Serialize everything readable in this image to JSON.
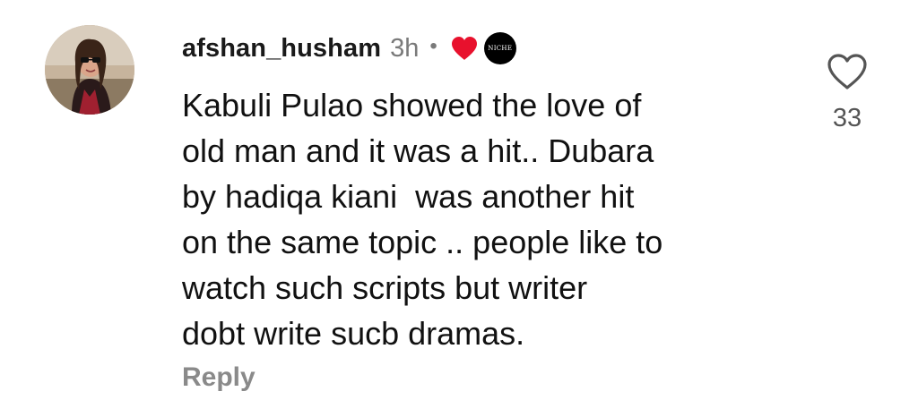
{
  "comment": {
    "username": "afshan_husham",
    "timestamp": "3h",
    "separator": "•",
    "creator_liked_icon": "heart-filled-icon",
    "creator_badge_text": "NICHE",
    "text_lines": [
      "Kabuli Pulao showed the love of",
      "old man and it was a hit.. Dubara",
      "by hadiqa kiani  was another hit",
      "on the same topic .. people like to",
      "watch such scripts but writer",
      "dobt write sucb dramas."
    ],
    "reply_label": "Reply",
    "like_icon": "heart-outline-icon",
    "like_count": "33"
  },
  "colors": {
    "creator_heart": "#e8112d",
    "muted_text": "#7a7a7a",
    "reply_text": "#8a8a8a"
  }
}
